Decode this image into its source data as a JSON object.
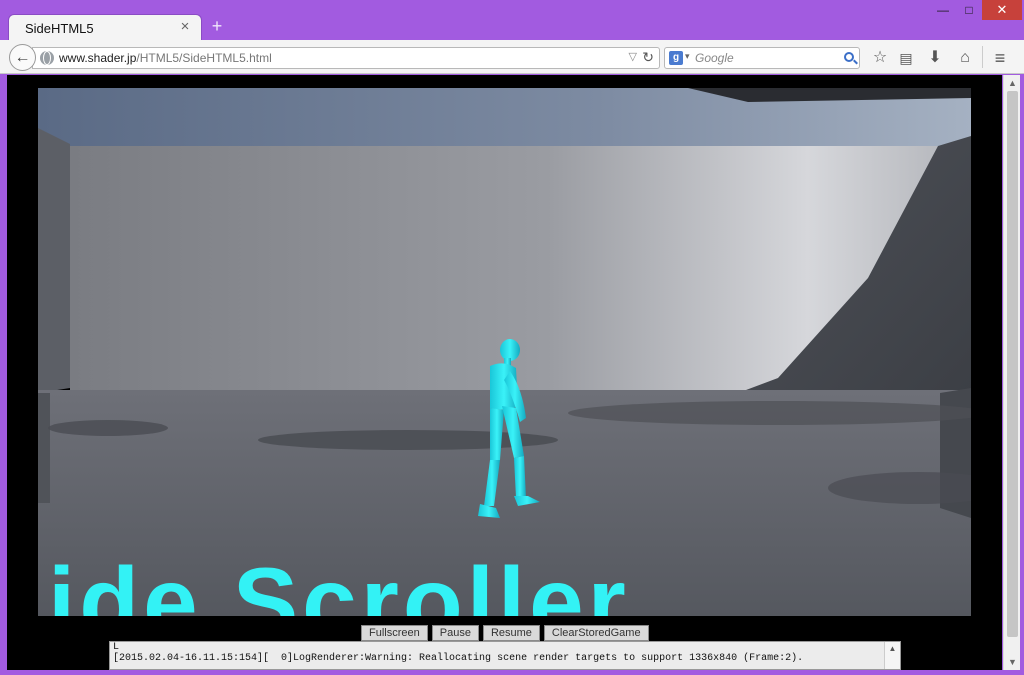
{
  "browser": {
    "tab_title": "SideHTML5",
    "tab_close": "×",
    "new_tab": "+",
    "window_min": "—",
    "window_max": "□",
    "window_close": "✕",
    "back": "←",
    "url_domain": "www.shader.jp",
    "url_path": "/HTML5/SideHTML5.html",
    "search_engine_letter": "g",
    "search_placeholder": "Google"
  },
  "game": {
    "floor_text": "ide Scroller",
    "character_color": "#2ee8f0",
    "floor_text_color": "#33f2f5"
  },
  "controls": {
    "buttons": [
      "Fullscreen",
      "Pause",
      "Resume",
      "ClearStoredGame"
    ]
  },
  "console": {
    "lines": [
      "L",
      "[2015.02.04-16.11.15:154][  0]LogRenderer:Warning: Reallocating scene render targets to support 1336x840 (Frame:2)."
    ]
  }
}
